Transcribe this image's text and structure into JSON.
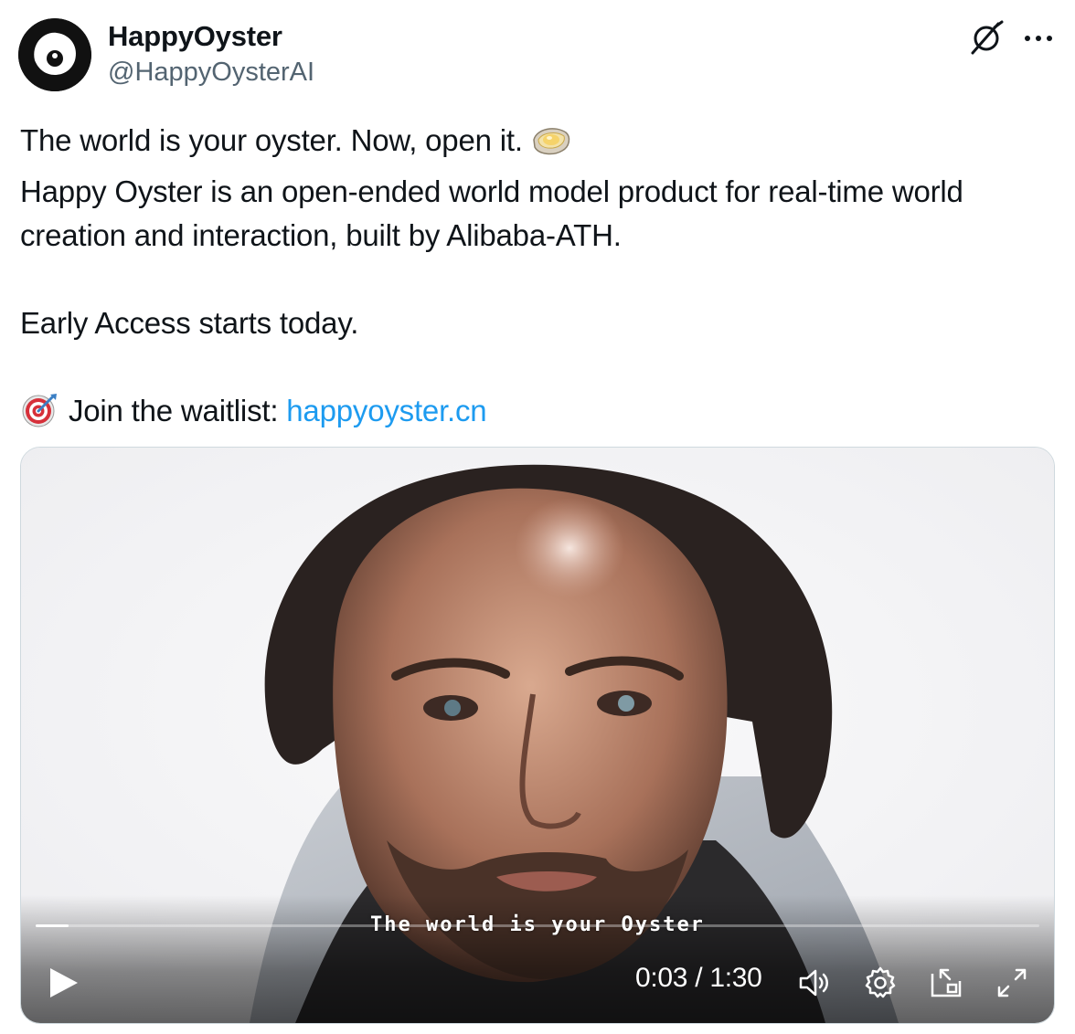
{
  "author": {
    "name": "HappyOyster",
    "handle": "@HappyOysterAI"
  },
  "tweet": {
    "line1": "The world is your oyster. Now, open it.",
    "line2": "Happy Oyster is an open-ended world model product for real-time world",
    "line3": "creation and interaction, built by Alibaba-ATH.",
    "line4": "Early Access starts today.",
    "waitlist_label": "Join the waitlist:",
    "waitlist_link": "happyoyster.cn"
  },
  "video": {
    "subtitle": "The world is your Oyster",
    "current_time": "0:03",
    "separator": " / ",
    "duration": "1:30",
    "progress": 0.033
  },
  "icons": {
    "grok": "grok-icon",
    "more": "more-icon",
    "oyster_emoji": "oyster-emoji-icon",
    "target_emoji": "direct-hit-icon",
    "play": "play-icon",
    "volume": "volume-icon",
    "settings": "gear-icon",
    "dock": "dock-icon",
    "fullscreen": "fullscreen-icon"
  },
  "colors": {
    "link": "#1d9bf0",
    "text": "#0f1419",
    "secondary": "#536471"
  }
}
